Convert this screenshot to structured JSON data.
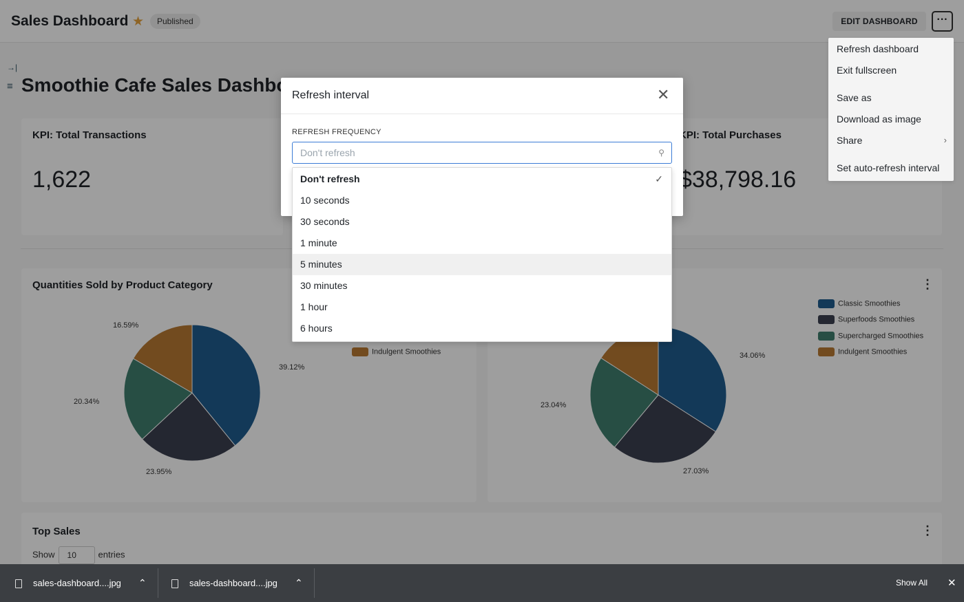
{
  "header": {
    "title": "Sales Dashboard",
    "status_badge": "Published",
    "edit_button": "EDIT DASHBOARD",
    "more_button": "···"
  },
  "page": {
    "title": "Smoothie Cafe Sales Dashboard"
  },
  "kpis": [
    {
      "title": "KPI: Total Transactions",
      "value": "1,622"
    },
    {
      "title": "KPI: Total Purchases",
      "value": "$38,798.16"
    }
  ],
  "charts": {
    "left_title": "Quantities Sold by Product Category",
    "left_legend_visible": "Indulgent Smoothies"
  },
  "chart_data": [
    {
      "type": "pie",
      "title": "Quantities Sold by Product Category",
      "categories": [
        "Classic Smoothies",
        "Superfoods Smoothies",
        "Supercharged Smoothies",
        "Indulgent Smoothies"
      ],
      "values": [
        39.12,
        23.95,
        20.34,
        16.59
      ],
      "labels": [
        "39.12%",
        "23.95%",
        "20.34%",
        "16.59%"
      ],
      "colors": [
        "#1f5d8f",
        "#3a3f4f",
        "#3f7e6e",
        "#b87a33"
      ]
    },
    {
      "type": "pie",
      "title": "",
      "categories": [
        "Classic Smoothies",
        "Superfoods Smoothies",
        "Supercharged Smoothies",
        "Indulgent Smoothies"
      ],
      "values": [
        34.06,
        27.03,
        23.04,
        15.87
      ],
      "labels": [
        "34.06%",
        "27.03%",
        "23.04%",
        ""
      ],
      "colors": [
        "#1f5d8f",
        "#3a3f4f",
        "#3f7e6e",
        "#b87a33"
      ],
      "legend": "top-right"
    }
  ],
  "table": {
    "title": "Top Sales",
    "show_label": "Show",
    "entries_value": "10",
    "entries_label": "entries"
  },
  "menu": {
    "items": [
      "Refresh dashboard",
      "Exit fullscreen",
      "Save as",
      "Download as image",
      "Share",
      "Set auto-refresh interval"
    ]
  },
  "modal": {
    "title": "Refresh interval",
    "field_label": "REFRESH FREQUENCY",
    "placeholder": "Don't refresh",
    "options": [
      "Don't refresh",
      "10 seconds",
      "30 seconds",
      "1 minute",
      "5 minutes",
      "30 minutes",
      "1 hour",
      "6 hours"
    ],
    "selected": "Don't refresh",
    "hovered": "5 minutes"
  },
  "downloads": {
    "items": [
      "sales-dashboard....jpg",
      "sales-dashboard....jpg"
    ],
    "show_all": "Show All"
  }
}
